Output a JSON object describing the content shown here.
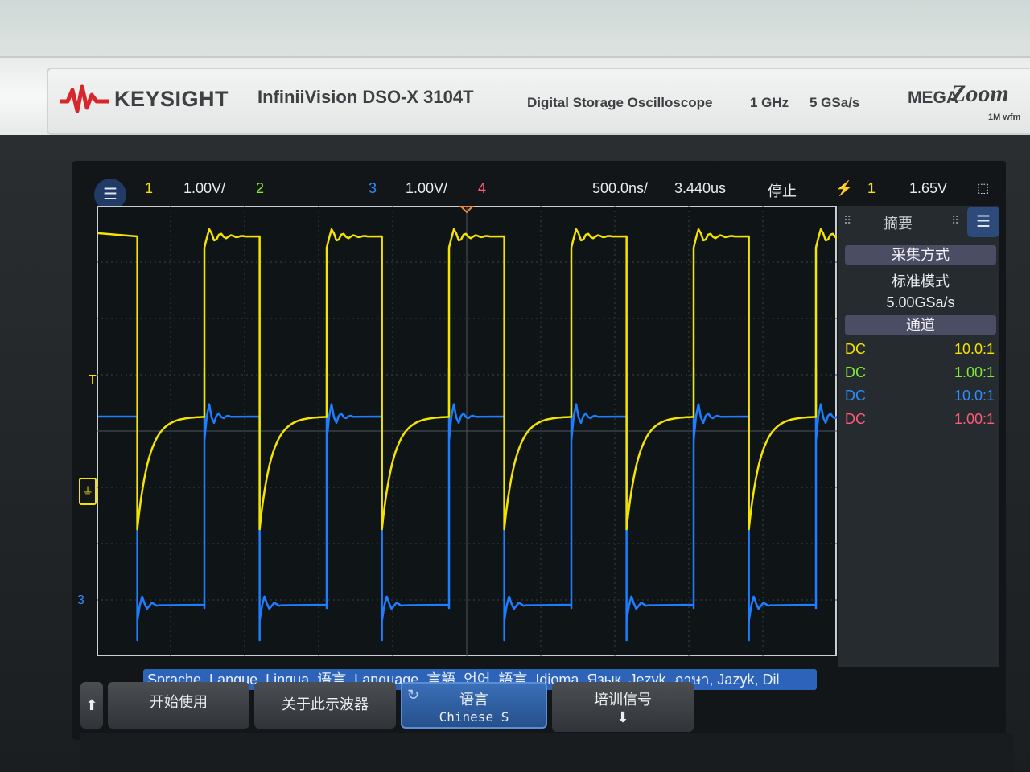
{
  "bezel": {
    "brand": "KEYSIGHT",
    "model": "InfiniiVision DSO-X 3104T",
    "description": "Digital Storage Oscilloscope",
    "bandwidth": "1 GHz",
    "sample_rate": "5 GSa/s",
    "mega_label": "MEGA",
    "zoom_label": "Zoom",
    "wfm_label": "1M wfm"
  },
  "status": {
    "ch1_num": "1",
    "ch1_scale": "1.00V/",
    "ch2_num": "2",
    "ch3_num": "3",
    "ch3_scale": "1.00V/",
    "ch4_num": "4",
    "timebase": "500.0ns/",
    "delay": "3.440us",
    "run_state": "停止",
    "trigger_source": "1",
    "trigger_level": "1.65V"
  },
  "markers": {
    "trigger_marker": "T",
    "ch3_marker": "3"
  },
  "side_panel": {
    "title": "摘要",
    "acq_header": "采集方式",
    "acq_mode": "标准模式",
    "acq_rate": "5.00GSa/s",
    "channels_header": "通道",
    "channels": [
      {
        "coupling": "DC",
        "ratio": "10.0:1",
        "color": "#f5e400"
      },
      {
        "coupling": "DC",
        "ratio": "1.00:1",
        "color": "#7fe83a"
      },
      {
        "coupling": "DC",
        "ratio": "10.0:1",
        "color": "#2f8cff"
      },
      {
        "coupling": "DC",
        "ratio": "1.00:1",
        "color": "#ff5a7a"
      }
    ]
  },
  "language_bar": "Sprache, Langue, Lingua, 语言, Language, 言語, 언어, 語言, Idioma, Язык, Jezyk, ภาษา, Jazyk, Dil",
  "softkeys": {
    "back_icon": "up-arrow-icon",
    "k1": "开始使用",
    "k2": "关于此示波器",
    "k3_title": "语言",
    "k3_value": "Chinese S",
    "k4": "培训信号"
  },
  "colors": {
    "ch1": "#f5e400",
    "ch3": "#1f7dff",
    "accent": "#2d63b8"
  }
}
